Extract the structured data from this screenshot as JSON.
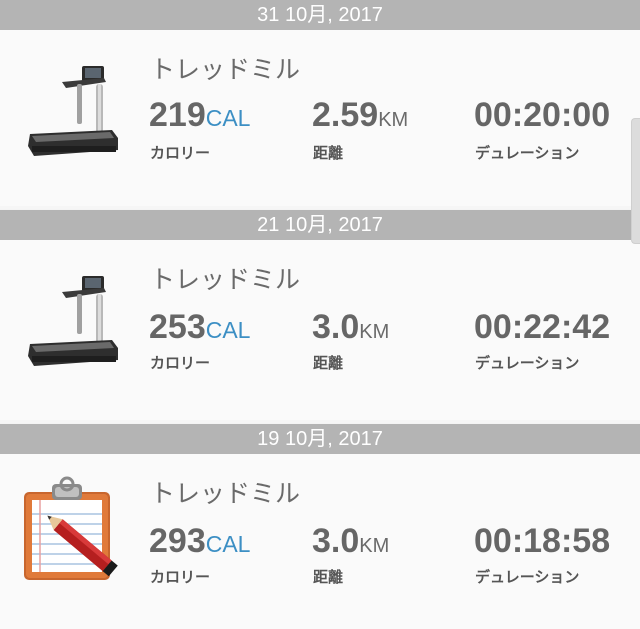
{
  "workouts": [
    {
      "date": "31 10月, 2017",
      "type": "トレッドミル",
      "icon": "treadmill-icon",
      "calories": "219",
      "calories_unit": "CAL",
      "calories_label": "カロリー",
      "distance": "2.59",
      "distance_unit": "KM",
      "distance_label": "距離",
      "duration": "00:20:00",
      "duration_label": "デュレーション"
    },
    {
      "date": "21 10月, 2017",
      "type": "トレッドミル",
      "icon": "treadmill-icon",
      "calories": "253",
      "calories_unit": "CAL",
      "calories_label": "カロリー",
      "distance": "3.0",
      "distance_unit": "KM",
      "distance_label": "距離",
      "duration": "00:22:42",
      "duration_label": "デュレーション"
    },
    {
      "date": "19 10月, 2017",
      "type": "トレッドミル",
      "icon": "clipboard-pencil-icon",
      "calories": "293",
      "calories_unit": "CAL",
      "calories_label": "カロリー",
      "distance": "3.0",
      "distance_unit": "KM",
      "distance_label": "距離",
      "duration": "00:18:58",
      "duration_label": "デュレーション"
    }
  ],
  "colors": {
    "header_bg": "#b4b4b4",
    "card_bg": "#fafafa",
    "accent_cal": "#3c8fc4",
    "value_text": "#666666"
  }
}
